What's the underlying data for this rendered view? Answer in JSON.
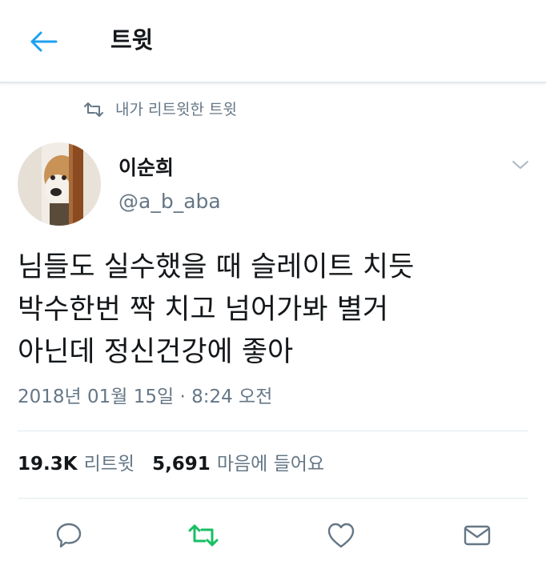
{
  "header": {
    "title": "트윗"
  },
  "retweet_context": {
    "label": "내가 리트윗한 트윗"
  },
  "tweet": {
    "author": {
      "display_name": "이순희",
      "handle": "@a_b_aba"
    },
    "text_lines": [
      "님들도 실수했을 때 슬레이트 치듯",
      "박수한번 짝 치고 넘어가봐 별거",
      "아닌데 정신건강에 좋아"
    ],
    "timestamp": "2018년 01월 15일 · 8:24 오전",
    "stats": {
      "retweets": "19.3K",
      "retweets_label": "리트윗",
      "likes": "5,691",
      "likes_label": "마음에 들어요"
    }
  },
  "colors": {
    "accent_blue": "#1da1f2",
    "retweet_green": "#17bf63",
    "secondary_text": "#657786",
    "border": "#e1e8ed"
  },
  "icons": {
    "back": "arrow-left-icon",
    "retweet_context": "retweet-icon",
    "caret": "chevron-down-icon",
    "reply": "reply-icon",
    "retweet": "retweet-icon",
    "like": "heart-icon",
    "message": "envelope-icon"
  }
}
